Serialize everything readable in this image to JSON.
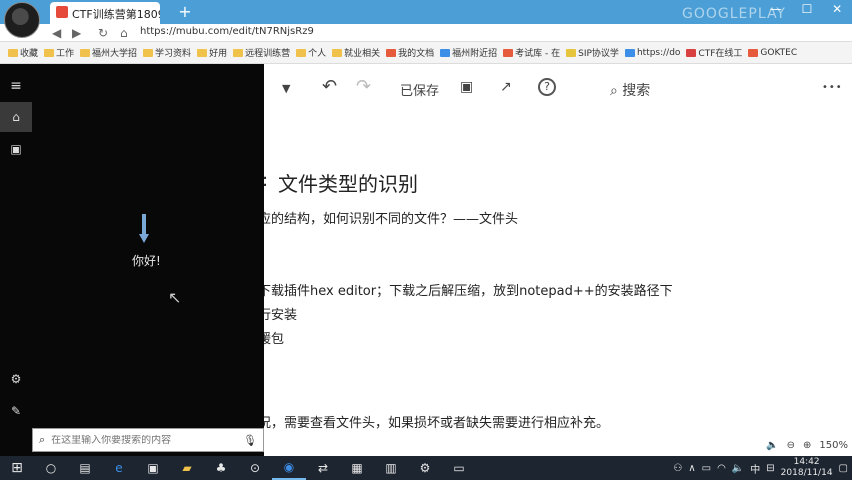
{
  "browser": {
    "tab_title": "CTF训练营第1809...",
    "brand": "GOOGLEPLAY",
    "url": "https://mubu.com/edit/tN7RNjsRz9",
    "bookmarks": [
      "收藏",
      "工作",
      "福州大学招",
      "学习资料",
      "好用",
      "远程训练营",
      "个人",
      "就业相关",
      "我的文档",
      "福州附近招",
      "考试库 - 在",
      "SIP协议学",
      "https://do",
      "CTF在线工",
      "GOKTEC"
    ]
  },
  "editor": {
    "saved_label": "已保存",
    "search_label": "搜索",
    "more_label": "•••",
    "doc_title": "文件类型的识别",
    "lines": [
      "应的结构，如何识别不同的文件？——文件头",
      "下载插件hex editor；下载之后解压缩，放到notepad++的安装路径下",
      "行安装",
      "缓包",
      "况，需要查看文件头，如果损坏或者缺失需要进行相应补充。"
    ],
    "zoom": "150%"
  },
  "start_menu": {
    "greeting": "你好!",
    "search_placeholder": "在这里输入你要搜索的内容"
  },
  "taskbar": {
    "time": "14:42",
    "date": "2018/11/14",
    "ime": "中"
  }
}
